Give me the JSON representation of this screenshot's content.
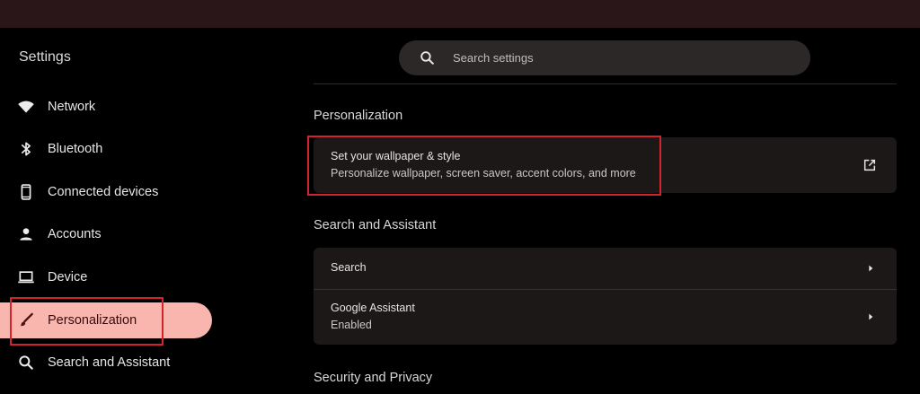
{
  "app": {
    "title": "Settings"
  },
  "search": {
    "placeholder": "Search settings"
  },
  "sidebar": {
    "items": [
      {
        "label": "Network",
        "icon": "wifi-icon"
      },
      {
        "label": "Bluetooth",
        "icon": "bluetooth-icon"
      },
      {
        "label": "Connected devices",
        "icon": "phone-icon"
      },
      {
        "label": "Accounts",
        "icon": "person-icon"
      },
      {
        "label": "Device",
        "icon": "laptop-icon"
      },
      {
        "label": "Personalization",
        "icon": "brush-icon",
        "active": true
      },
      {
        "label": "Search and Assistant",
        "icon": "search-icon"
      }
    ]
  },
  "sections": {
    "personalization": {
      "heading": "Personalization",
      "wallpaper": {
        "title": "Set your wallpaper & style",
        "subtitle": "Personalize wallpaper, screen saver, accent colors, and more",
        "trailing_icon": "open-in-new-icon"
      }
    },
    "search_assistant": {
      "heading": "Search and Assistant",
      "search_row": {
        "title": "Search",
        "trailing_icon": "chevron-right-icon"
      },
      "assistant_row": {
        "title": "Google Assistant",
        "subtitle": "Enabled",
        "trailing_icon": "chevron-right-icon"
      }
    },
    "security": {
      "heading": "Security and Privacy"
    }
  },
  "colors": {
    "titlebar": "#2a1618",
    "active_nav_bg": "#f9b6af",
    "highlight_box": "#d3242b",
    "card_bg": "#1c1818",
    "search_bg": "#2c2828"
  }
}
